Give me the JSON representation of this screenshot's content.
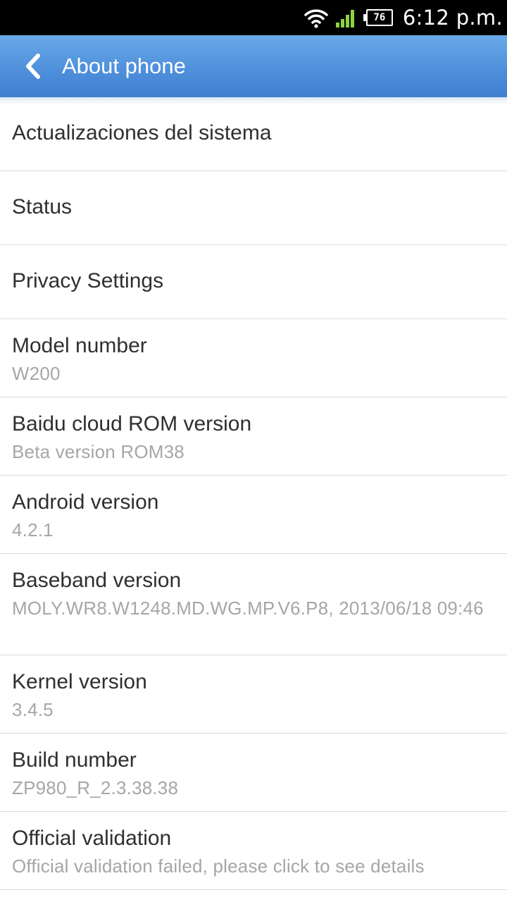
{
  "status_bar": {
    "time": "6:12 p.m.",
    "battery_level": "76",
    "icons": [
      "wifi-icon",
      "signal-icon",
      "battery-icon"
    ]
  },
  "action_bar": {
    "title": "About phone",
    "back_icon": "chevron-left-icon"
  },
  "items": [
    {
      "title": "Actualizaciones del sistema"
    },
    {
      "title": "Status"
    },
    {
      "title": "Privacy Settings"
    },
    {
      "title": "Model number",
      "summary": "W200"
    },
    {
      "title": "Baidu cloud ROM version",
      "summary": "Beta version ROM38"
    },
    {
      "title": "Android version",
      "summary": "4.2.1"
    },
    {
      "title": "Baseband version",
      "summary": "MOLY.WR8.W1248.MD.WG.MP.V6.P8, 2013/06/18 09:46"
    },
    {
      "title": "Kernel version",
      "summary": "3.4.5"
    },
    {
      "title": "Build number",
      "summary": "ZP980_R_2.3.38.38"
    },
    {
      "title": "Official validation",
      "summary": "Official validation failed, please click to see details"
    }
  ],
  "colors": {
    "action_bar": "#4f90dc",
    "title_text": "#2f2f2f",
    "summary_text": "#a6a6a6",
    "divider": "#dcdcdc"
  }
}
